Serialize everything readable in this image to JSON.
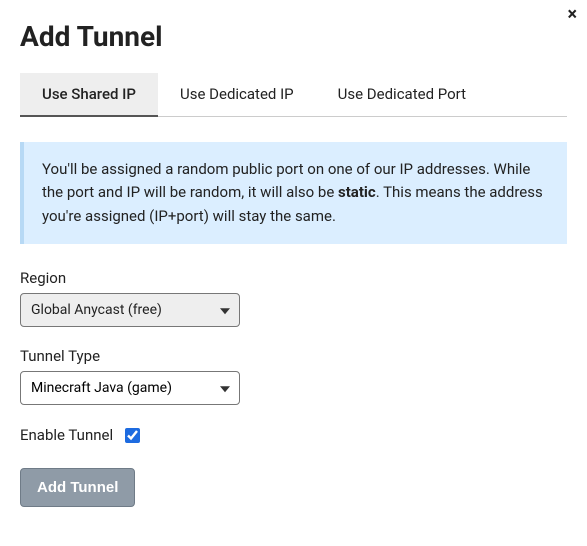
{
  "title": "Add Tunnel",
  "close_label": "×",
  "tabs": [
    {
      "label": "Use Shared IP",
      "active": true
    },
    {
      "label": "Use Dedicated IP",
      "active": false
    },
    {
      "label": "Use Dedicated Port",
      "active": false
    }
  ],
  "info": {
    "pre": "You'll be assigned a random public port on one of our IP addresses. While the port and IP will be random, it will also be ",
    "bold": "static",
    "post": ". This means the address you're assigned (IP+port) will stay the same."
  },
  "region": {
    "label": "Region",
    "value": "Global Anycast (free)"
  },
  "tunnel_type": {
    "label": "Tunnel Type",
    "value": "Minecraft Java (game)"
  },
  "enable_tunnel": {
    "label": "Enable Tunnel",
    "checked": true
  },
  "submit_label": "Add Tunnel"
}
